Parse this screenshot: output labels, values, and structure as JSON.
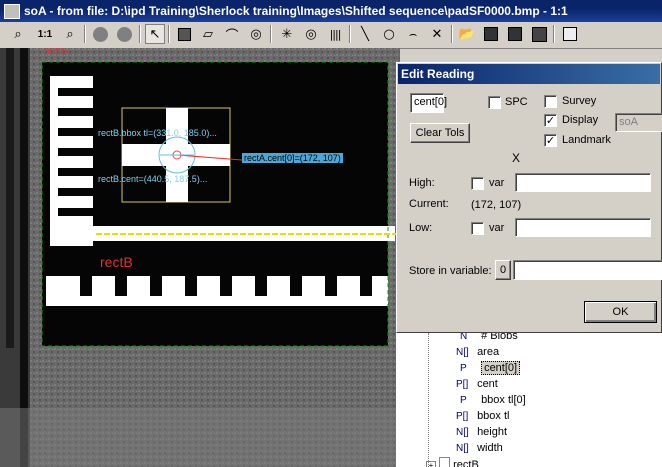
{
  "window": {
    "title": "soA - from file: D:\\ipd Training\\Sherlock training\\Images\\Shifted sequence\\padSF0000.bmp - 1:1"
  },
  "toolbar": {
    "zoom_level": "1:1"
  },
  "overlay": {
    "roi_label_top": "rectB",
    "roi_label_bottom": "rectB",
    "bbox_text": "rectB.bbox tl=(331.0, 185.0)...",
    "cent_text": "rectB.cent=(440.5, 187.5)...",
    "reading_tag": "rectA.cent[0]=(172, 107)"
  },
  "dialog": {
    "title": "Edit Reading",
    "reading_name": "cent[0]",
    "clear_tols_label": "Clear Tols",
    "spc_label": "SPC",
    "survey_label": "Survey",
    "display_label": "Display",
    "display_target": "soA",
    "landmark_label": "Landmark",
    "x_mark": "X",
    "high_label": "High:",
    "high_var_label": "var",
    "high_value": "",
    "current_label": "Current:",
    "current_value": "(172, 107)",
    "low_label": "Low:",
    "low_var_label": "var",
    "low_value": "",
    "store_label": "Store in variable:",
    "store_index": "0",
    "store_value": "",
    "ok_label": "OK",
    "checks": {
      "spc": false,
      "survey": false,
      "display": true,
      "landmark": true,
      "high_var": false,
      "low_var": false
    }
  },
  "tree": {
    "items": [
      {
        "type": "N",
        "label": "# Blobs"
      },
      {
        "type": "N[]",
        "label": "area"
      },
      {
        "type": "P",
        "label": "cent[0]"
      },
      {
        "type": "P[]",
        "label": "cent"
      },
      {
        "type": "P",
        "label": "bbox tl[0]"
      },
      {
        "type": "P[]",
        "label": "bbox tl"
      },
      {
        "type": "N[]",
        "label": "height"
      },
      {
        "type": "N[]",
        "label": "width"
      }
    ],
    "next_item": "rectB"
  }
}
